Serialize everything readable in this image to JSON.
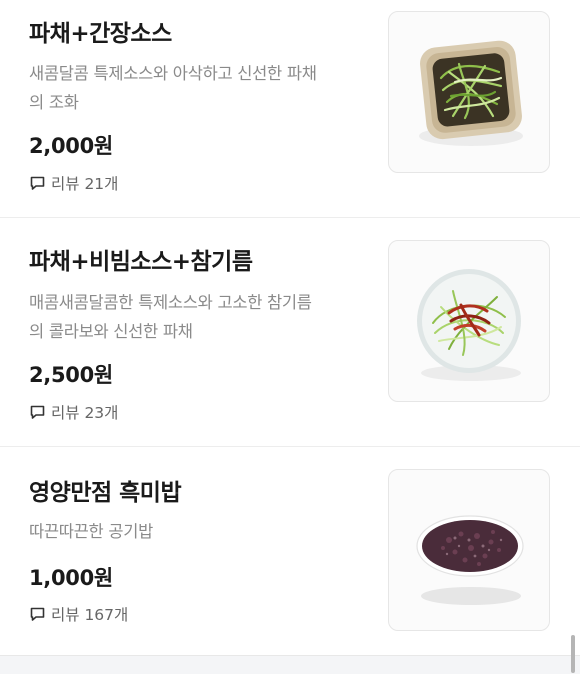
{
  "menu": [
    {
      "name": "파채+간장소스",
      "desc_lines": [
        "새콤달콤 특제소스와 아삭하고 신선한 파채",
        "의 조화"
      ],
      "price": "2,000원",
      "review": "리뷰 21개",
      "image": "scallion-salad-soy-sauce-square-bowl"
    },
    {
      "name": "파채+비빔소스+참기름",
      "desc_lines": [
        "매콤새콤달콤한 특제소스와 고소한 참기름",
        "의 콜라보와 신선한 파채"
      ],
      "price": "2,500원",
      "review": "리뷰 23개",
      "image": "scallion-salad-spicy-sauce-round-plate"
    },
    {
      "name": "영양만점 흑미밥",
      "desc_lines": [
        "따끈따끈한 공기밥"
      ],
      "price": "1,000원",
      "review": "리뷰 167개",
      "image": "black-rice-bowl"
    }
  ],
  "icons": {
    "review": "speech-bubble-icon"
  },
  "colors": {
    "text": "#1a1a1a",
    "muted": "#8a8a8a",
    "divider": "#ededed"
  }
}
